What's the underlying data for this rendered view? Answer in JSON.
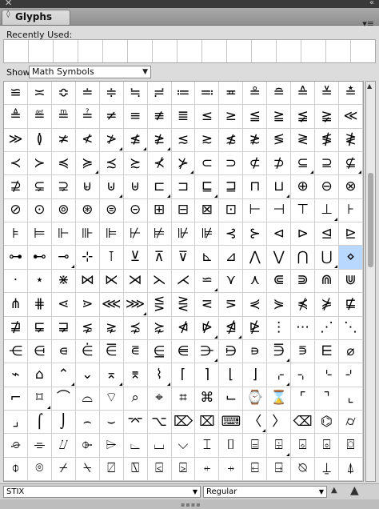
{
  "panel": {
    "close_glyph": "✕",
    "collapse_glyph": "«",
    "tab_title": "Glyphs",
    "tab_icon": "◊",
    "menu_glyph": "▾≡"
  },
  "recent": {
    "label": "Recently Used:",
    "slot_count": 15
  },
  "show": {
    "label": "Show:",
    "value": "Math Symbols"
  },
  "glyphs": [
    "≌",
    "≍",
    "≎",
    "≐",
    "≑",
    "≒",
    "≓",
    "≔",
    "≕",
    "≖",
    "≗",
    "≘",
    "≙",
    "≚",
    "≛",
    "≜",
    "≝",
    "≞",
    "≟",
    "≠",
    "≡",
    "≢",
    "≣",
    "≤",
    "≥",
    "≦",
    "≧",
    "≨",
    "≩",
    "≪",
    "≫",
    "≬",
    "≭",
    "≮",
    "≯",
    "≰",
    "≱",
    "≲",
    "≳",
    "≴",
    "≵",
    "≶",
    "≷",
    "≸",
    "≹",
    "≺",
    "≻",
    "≼",
    "≽",
    "≾",
    "≿",
    "⊀",
    "⊁",
    "⊂",
    "⊃",
    "⊄",
    "⊅",
    "⊆",
    "⊇",
    "⊈",
    "⊉",
    "⊊",
    "⊋",
    "⊌",
    "⊍",
    "⊎",
    "⊏",
    "⊐",
    "⊑",
    "⊒",
    "⊓",
    "⊔",
    "⊕",
    "⊖",
    "⊗",
    "⊘",
    "⊙",
    "⊚",
    "⊛",
    "⊜",
    "⊝",
    "⊞",
    "⊟",
    "⊠",
    "⊡",
    "⊢",
    "⊣",
    "⊤",
    "⊥",
    "⊦",
    "⊧",
    "⊨",
    "⊩",
    "⊪",
    "⊫",
    "⊬",
    "⊭",
    "⊮",
    "⊯",
    "⊰",
    "⊱",
    "⊲",
    "⊳",
    "⊴",
    "⊵",
    "⊶",
    "⊷",
    "⊸",
    "⊹",
    "⊺",
    "⊻",
    "⊼",
    "⊽",
    "⊾",
    "⊿",
    "⋀",
    "⋁",
    "⋂",
    "⋃",
    "⋄",
    "⋅",
    "⋆",
    "⋇",
    "⋈",
    "⋉",
    "⋊",
    "⋋",
    "⋌",
    "⋍",
    "⋎",
    "⋏",
    "⋐",
    "⋑",
    "⋒",
    "⋓",
    "⋔",
    "⋕",
    "⋖",
    "⋗",
    "⋘",
    "⋙",
    "⋚",
    "⋛",
    "⋜",
    "⋝",
    "⋞",
    "⋟",
    "⋠",
    "⋡",
    "⋢",
    "⋣",
    "⋤",
    "⋥",
    "⋦",
    "⋧",
    "⋨",
    "⋩",
    "⋪",
    "⋫",
    "⋬",
    "⋭",
    "⋮",
    "⋯",
    "⋰",
    "⋱",
    "⋲",
    "⋳",
    "⋴",
    "⋵",
    "⋶",
    "⋷",
    "⋸",
    "⋹",
    "⋺",
    "⋻",
    "⋼",
    "⋽",
    "⋾",
    "⋿",
    "⌀",
    "⌁",
    "⌂",
    "⌃",
    "⌄",
    "⌅",
    "⌆",
    "⌇",
    "⌈",
    "⌉",
    "⌊",
    "⌋",
    "⌌",
    "⌍",
    "⌎",
    "⌏",
    "⌐",
    "⌑",
    "⌒",
    "⌓",
    "⌔",
    "⌕",
    "⌖",
    "⌗",
    "⌘",
    "⌙",
    "⌚",
    "⌛",
    "⌜",
    "⌝",
    "⌞",
    "⌟",
    "⌠",
    "⌡",
    "⌢",
    "⌣",
    "⌤",
    "⌥",
    "⌦",
    "⌧",
    "⌨",
    "〈",
    "〉",
    "⌫",
    "⌬",
    "⌭",
    "⌮",
    "⌯",
    "⌰",
    "⌱",
    "⌲",
    "⌳",
    "⌴",
    "⌵",
    "⌶",
    "⌷",
    "⌸",
    "⌹",
    "⌺",
    "⌻",
    "⌼",
    "⌽",
    "⌾",
    "⌿",
    "⍀",
    "⍁",
    "⍂",
    "⍃",
    "⍄",
    "⍅",
    "⍆",
    "⍇",
    "⍈",
    "⍉",
    "⍊",
    "⍋"
  ],
  "alternates_marked": [
    34,
    35,
    36,
    48,
    52,
    57,
    59,
    64,
    66,
    68,
    71,
    88,
    107,
    118,
    128,
    140,
    158,
    159,
    173,
    176,
    182,
    184,
    186,
    191,
    196,
    220,
    236
  ],
  "selected_index": 119,
  "bottom": {
    "font_value": "STIX",
    "style_value": "Regular",
    "zoom_out": "▲",
    "zoom_in": "▲"
  },
  "colors": {
    "selection": "#b8d8ff",
    "panel": "#dcdcdc"
  }
}
